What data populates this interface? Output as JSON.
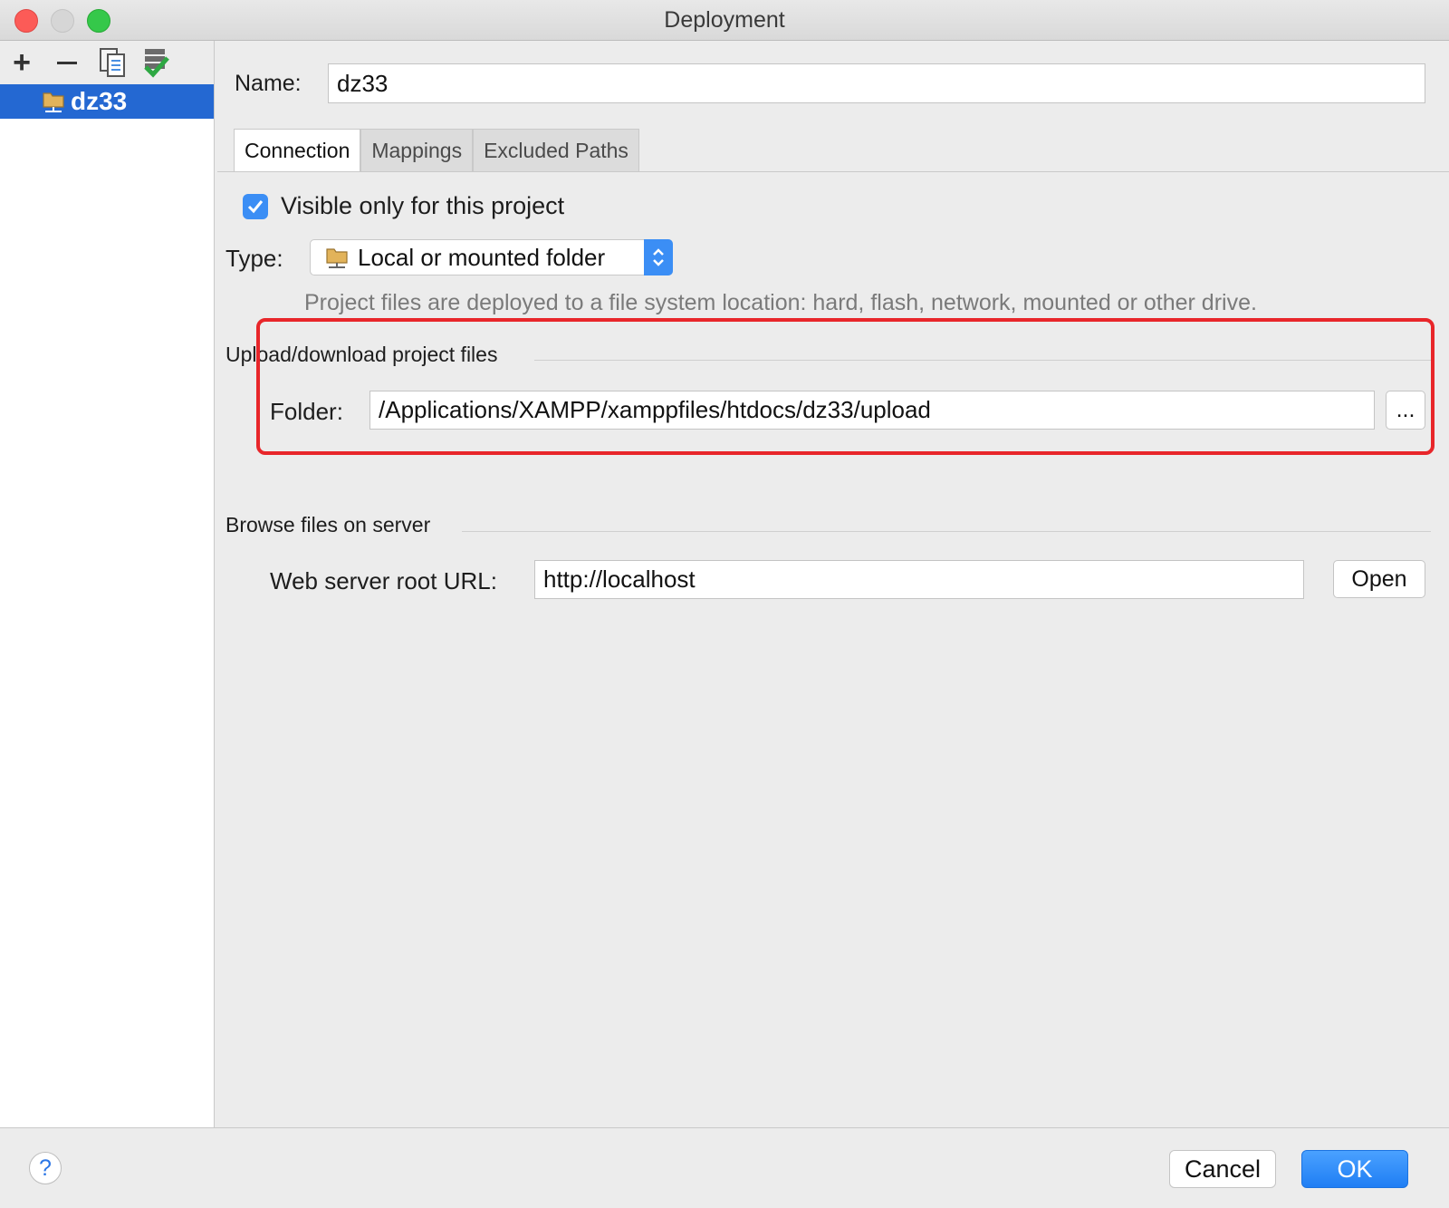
{
  "window": {
    "title": "Deployment"
  },
  "sidebar": {
    "toolbar": {
      "add": "+",
      "remove": "−"
    },
    "items": [
      {
        "label": "dz33",
        "icon": "server-folder-icon",
        "selected": true
      }
    ]
  },
  "form": {
    "name_label": "Name:",
    "name_value": "dz33",
    "tabs": [
      {
        "label": "Connection",
        "active": true
      },
      {
        "label": "Mappings",
        "active": false
      },
      {
        "label": "Excluded Paths",
        "active": false
      }
    ],
    "visible_only": {
      "label": "Visible only for this project",
      "checked": true
    },
    "type_label": "Type:",
    "type_value": "Local or mounted folder",
    "type_hint": "Project files are deployed to a file system location:  hard, flash, network, mounted or other drive.",
    "upload_group": "Upload/download project files",
    "folder_label": "Folder:",
    "folder_value": "/Applications/XAMPP/xamppfiles/htdocs/dz33/upload",
    "browse_button": "...",
    "browse_group": "Browse files on server",
    "url_label": "Web server root URL:",
    "url_value": "http://localhost",
    "open_button": "Open"
  },
  "footer": {
    "help": "?",
    "cancel": "Cancel",
    "ok": "OK"
  },
  "colors": {
    "accent": "#2468d2",
    "button_blue": "#3b8ef5",
    "highlight": "#e8262a"
  }
}
